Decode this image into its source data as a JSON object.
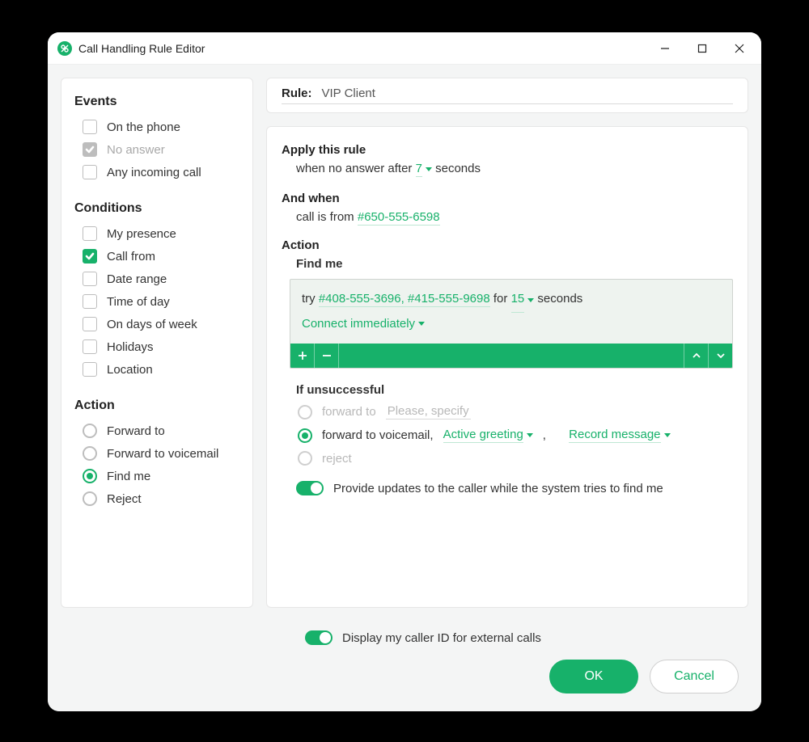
{
  "window": {
    "title": "Call Handling Rule Editor"
  },
  "sidebar": {
    "events_title": "Events",
    "events": [
      {
        "label": "On the phone",
        "checked": false,
        "disabled": false
      },
      {
        "label": "No answer",
        "checked": true,
        "disabled": true
      },
      {
        "label": "Any incoming call",
        "checked": false,
        "disabled": false
      }
    ],
    "conditions_title": "Conditions",
    "conditions": [
      {
        "label": "My presence",
        "checked": false
      },
      {
        "label": "Call from",
        "checked": true
      },
      {
        "label": "Date range",
        "checked": false
      },
      {
        "label": "Time of day",
        "checked": false
      },
      {
        "label": "On days of week",
        "checked": false
      },
      {
        "label": "Holidays",
        "checked": false
      },
      {
        "label": "Location",
        "checked": false
      }
    ],
    "action_title": "Action",
    "actions": [
      {
        "label": "Forward to",
        "selected": false
      },
      {
        "label": "Forward to voicemail",
        "selected": false
      },
      {
        "label": "Find me",
        "selected": true
      },
      {
        "label": "Reject",
        "selected": false
      }
    ]
  },
  "rule": {
    "label": "Rule:",
    "name": "VIP Client"
  },
  "apply": {
    "title": "Apply this rule",
    "prefix": "when no answer after",
    "seconds_value": "7",
    "seconds_suffix": "seconds"
  },
  "andwhen": {
    "title": "And when",
    "prefix": "call is from",
    "number": "#650-555-6598"
  },
  "action": {
    "title": "Action",
    "subtitle": "Find me",
    "try_prefix": "try",
    "try_numbers": "#408-555-3696, #415-555-9698",
    "for_word": "for",
    "for_value": "15",
    "seconds": "seconds",
    "connect": "Connect immediately",
    "unsuccessful_title": "If unsuccessful",
    "opt_forward_to": "forward to",
    "opt_forward_placeholder": "Please, specify",
    "opt_voicemail": "forward to voicemail,",
    "greeting": "Active greeting",
    "record": "Record message",
    "opt_reject": "reject",
    "provide_updates": "Provide updates to the caller while the system tries to find me"
  },
  "footer": {
    "display_caller_id": "Display my caller ID for external calls",
    "ok": "OK",
    "cancel": "Cancel"
  }
}
